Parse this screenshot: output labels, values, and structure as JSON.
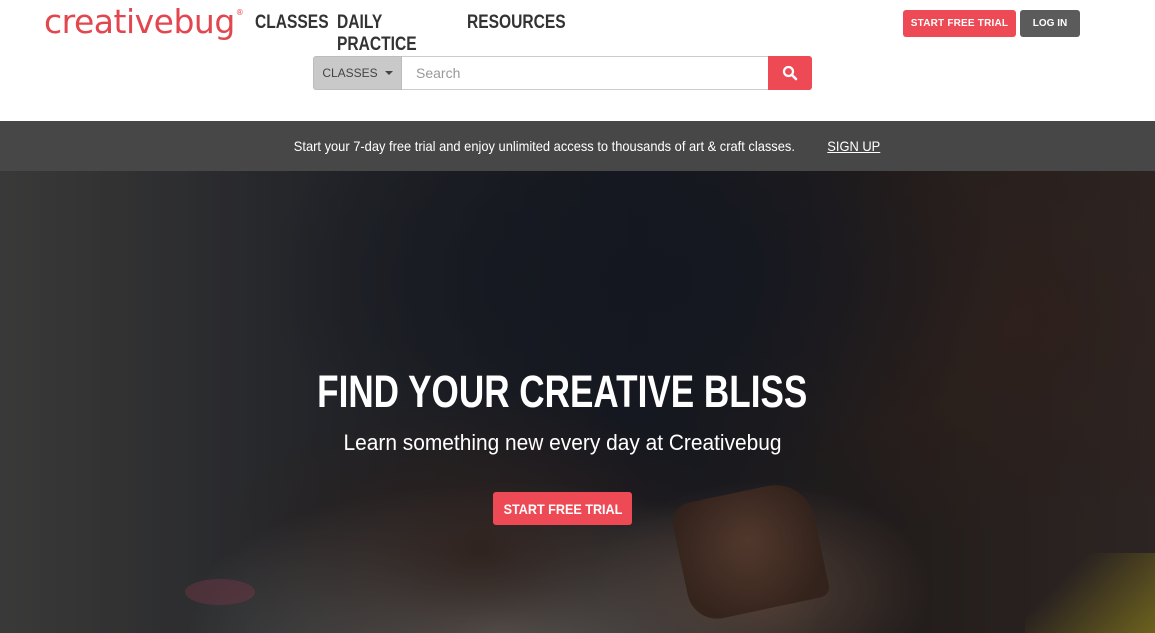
{
  "header": {
    "logo_text": "creativebug",
    "logo_mark": "®",
    "nav": [
      "CLASSES",
      "DAILY PRACTICE",
      "RESOURCES"
    ],
    "start_trial_label": "START FREE TRIAL",
    "login_label": "LOG IN"
  },
  "search": {
    "category_label": "CLASSES",
    "placeholder": "Search",
    "value": "",
    "button_icon": "search-icon"
  },
  "promo": {
    "text": "Start your 7-day free trial and enjoy unlimited access to thousands of art & craft classes.",
    "link_label": "SIGN UP"
  },
  "hero": {
    "title": "FIND YOUR CREATIVE BLISS",
    "subtitle": "Learn something new every day at Creativebug",
    "cta_label": "START FREE TRIAL"
  },
  "colors": {
    "accent": "#ee4a55",
    "logo": "#e2474f",
    "promo_bg": "#474747",
    "login_bg": "#5b5b5b"
  }
}
